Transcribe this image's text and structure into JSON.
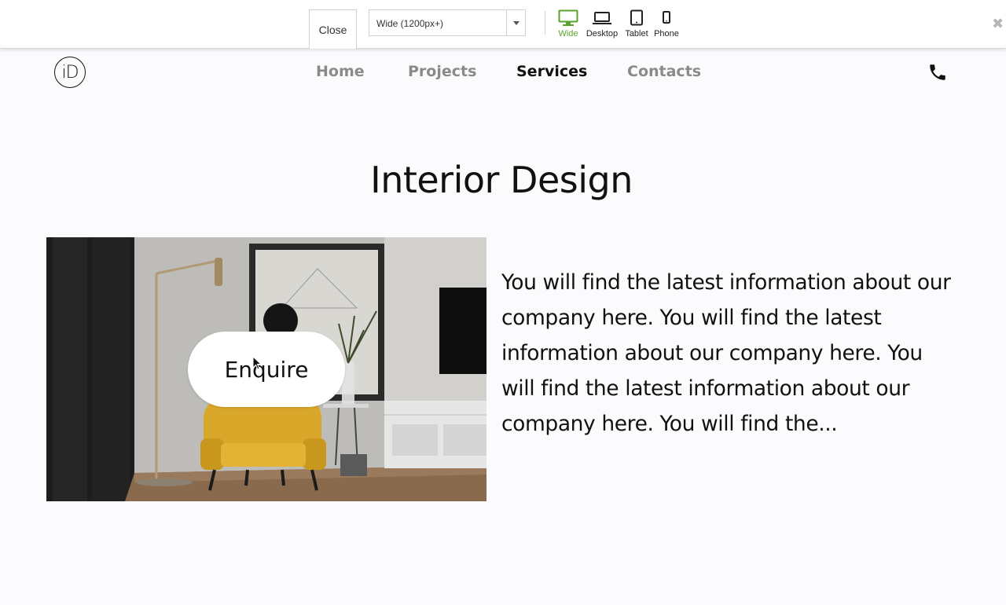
{
  "toolbar": {
    "close_label": "Close",
    "viewport_select": {
      "value": "Wide (1200px+)"
    },
    "devices": [
      {
        "label": "Wide",
        "icon": "monitor-icon",
        "active": true
      },
      {
        "label": "Desktop",
        "icon": "laptop-icon",
        "active": false
      },
      {
        "label": "Tablet",
        "icon": "tablet-icon",
        "active": false
      },
      {
        "label": "Phone",
        "icon": "phone-device-icon",
        "active": false
      }
    ],
    "dismiss_glyph": "✖",
    "active_color": "#5aa02c"
  },
  "site": {
    "logo_text": "iD",
    "nav": [
      {
        "label": "Home",
        "active": false
      },
      {
        "label": "Projects",
        "active": false
      },
      {
        "label": "Services",
        "active": true
      },
      {
        "label": "Contacts",
        "active": false
      }
    ],
    "phone_icon": "phone-icon"
  },
  "content": {
    "title": "Interior Design",
    "enquire_label": "Enquire",
    "image_alt": "Living room with yellow armchair and floor lamp",
    "body": "You will find the latest information about our company here. You will find the latest information about our company here. You will find the latest information about our company here. You will find the..."
  }
}
